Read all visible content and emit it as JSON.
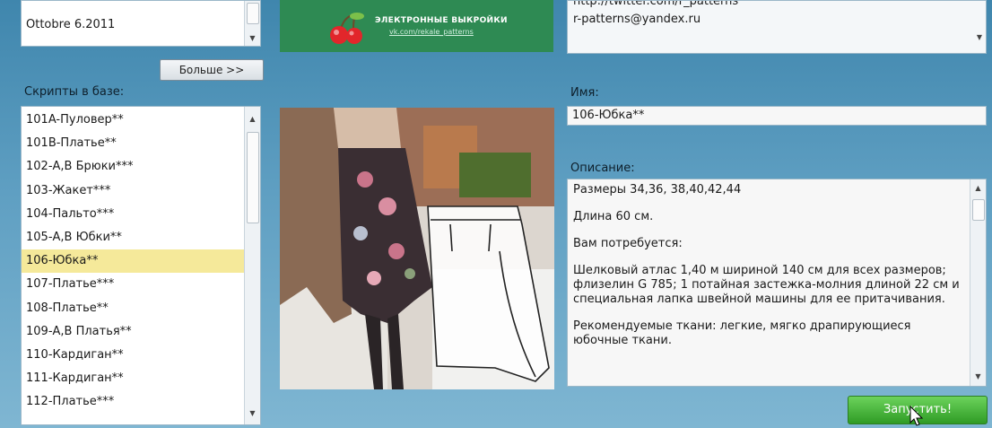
{
  "top_list": {
    "visible_item": "Ottobre 6.2011"
  },
  "banner": {
    "title": "ЭЛЕКТРОННЫЕ ВЫКРОЙКИ",
    "subtitle": "vk.com/rekale_patterns"
  },
  "contacts": {
    "line1": "http://twitter.com/r_patterns",
    "line2": "r-patterns@yandex.ru"
  },
  "more_button": "Больше >>",
  "scripts_label": "Скрипты в базе:",
  "scripts": [
    "101A-Пуловер**",
    "101B-Платье**",
    "102-А,В Брюки***",
    "103-Жакет***",
    "104-Пальто***",
    "105-А,В Юбки**",
    "106-Юбка**",
    "107-Платье***",
    "108-Платье**",
    "109-А,В Платья**",
    "110-Кардиган**",
    "111-Кардиган**",
    "112-Платье***"
  ],
  "selected_script": "106-Юбка**",
  "name_label": "Имя:",
  "name_value": "106-Юбка**",
  "description_label": "Описание:",
  "description": [
    "Размеры 34,36, 38,40,42,44",
    "Длина 60 см.",
    "Вам потребуется:",
    "Шелковый атлас 1,40 м шириной 140 см для всех размеров; флизелин G 785; 1 потайная застежка-молния длиной 22 см и специальная лапка швейной машины для ее притачивания.",
    "Рекомендуемые ткани: легкие, мягко драпирующиеся юбочные ткани."
  ],
  "run_button": "Запустить!",
  "colors": {
    "background": "#5f9fc2",
    "selection": "#f5e99a",
    "run_button": "#3fae33",
    "banner": "#2e8a53"
  }
}
